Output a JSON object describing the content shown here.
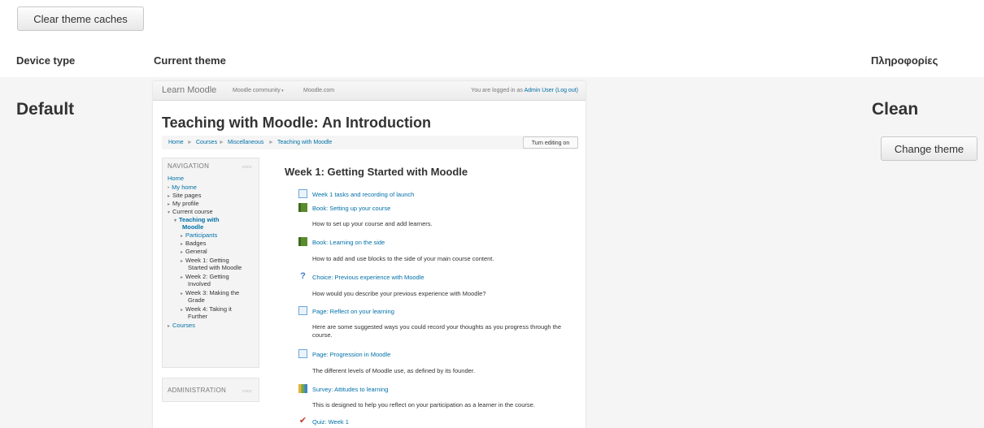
{
  "toolbar": {
    "clear_caches": "Clear theme caches"
  },
  "table": {
    "headers": {
      "device": "Device type",
      "theme": "Current theme",
      "info": "Πληροφορίες"
    },
    "row": {
      "device": "Default",
      "theme": "Clean",
      "change_button": "Change theme"
    }
  },
  "screenshot": {
    "navbar": {
      "brand": "Learn Moodle",
      "links": [
        "Moodle community",
        "Moodle.com"
      ],
      "login_prefix": "You are logged in as",
      "login_user": "Admin User",
      "logout": "(Log out)"
    },
    "course_title": "Teaching with Moodle: An Introduction",
    "breadcrumb": [
      "Home",
      "Courses",
      "Miscellaneous",
      "Teaching with Moodle"
    ],
    "edit_button": "Turn editing on",
    "navigation": {
      "title": "NAVIGATION",
      "items": [
        "Home",
        "My home",
        "Site pages",
        "My profile",
        "Current course",
        "Teaching with",
        "Moodle",
        "Participants",
        "Badges",
        "General",
        "Week 1: Getting",
        "Started with Moodle",
        "Week 2: Getting",
        "Involved",
        "Week 3: Making the",
        "Grade",
        "Week 4: Taking it",
        "Further",
        "Courses"
      ]
    },
    "administration": {
      "title": "ADMINISTRATION"
    },
    "week_title": "Week 1: Getting Started with Moodle",
    "activities": [
      {
        "icon": "page-icon",
        "name": "Week 1 tasks and recording of launch",
        "desc": ""
      },
      {
        "icon": "book-icon",
        "name": "Book: Setting up your course",
        "desc": "How to set up your course and add learners."
      },
      {
        "icon": "book-icon",
        "name": "Book: Learning on the side",
        "desc": "How to add and use blocks to the side of your main course content."
      },
      {
        "icon": "choice-icon",
        "name": "Choice: Previous experience with Moodle",
        "desc": "How would you describe your previous experience with Moodle?"
      },
      {
        "icon": "page-icon",
        "name": "Page: Reflect on your learning",
        "desc": "Here are some suggested ways you could record your thoughts as you progress through the course."
      },
      {
        "icon": "page-icon",
        "name": "Page: Progression in Moodle",
        "desc": "The different levels of Moodle use, as defined by its founder."
      },
      {
        "icon": "survey-icon",
        "name": "Survey: Attitudes to learning",
        "desc": "This is designed to help you reflect on your participation as a learner in the course."
      },
      {
        "icon": "quiz-icon",
        "name": "Quiz: Week 1",
        "desc": ""
      }
    ]
  }
}
